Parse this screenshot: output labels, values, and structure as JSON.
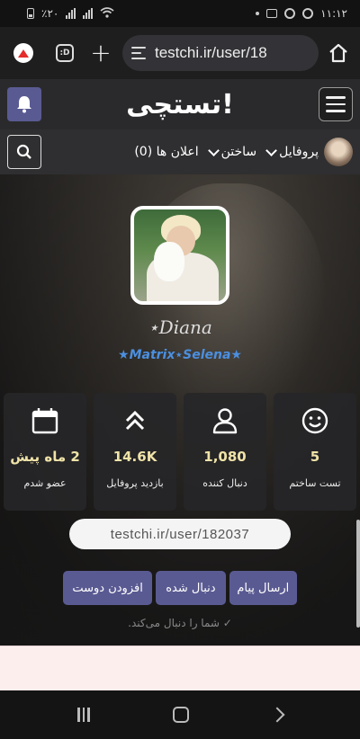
{
  "status_bar": {
    "time": "۱۱:۱۲",
    "battery": "٪۲۰"
  },
  "browser": {
    "url": "testchi.ir/user/18",
    "tab_icon_label": ":D"
  },
  "site": {
    "logo": "تستچی!"
  },
  "nav": {
    "profile": "پروفایل",
    "build": "ساختن",
    "notifications": "اعلان ها (0)"
  },
  "profile": {
    "name": "⋆Diana",
    "subtitle": "★Matrix⋆Selena★"
  },
  "stats": [
    {
      "icon": "smiley-icon",
      "value": "5",
      "label": "تست ساختم"
    },
    {
      "icon": "user-icon",
      "value": "1,080",
      "label": "دنبال کننده"
    },
    {
      "icon": "double-chevron-up-icon",
      "value": "14.6K",
      "label": "بازدید پروفایل"
    },
    {
      "icon": "calendar-icon",
      "value": "2 ماه پیش",
      "label": "عضو شدم"
    }
  ],
  "profile_link": "testchi.ir/user/182037",
  "actions": {
    "send_message": "ارسال پیام",
    "followed": "دنبال شده",
    "add_friend": "افزودن دوست"
  },
  "follow_note": "✓ شما را دنبال می‌کند.",
  "colors": {
    "accent": "#5a5a93",
    "stat_value": "#f0e3a8",
    "subtitle": "#4b8fe0"
  }
}
